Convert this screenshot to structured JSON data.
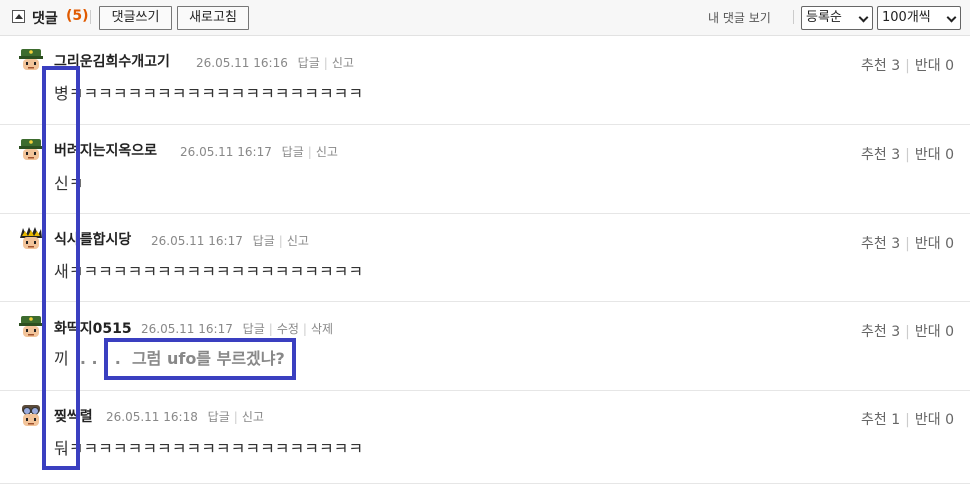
{
  "topbar": {
    "title": "댓글",
    "count": "(5)",
    "write_button": "댓글쓰기",
    "refresh_button": "새로고침",
    "my_comments": "내 댓글 보기",
    "sort_select": "등록순",
    "page_size_select": "100개씩"
  },
  "comments": [
    {
      "author": "그리운김희수개고기",
      "time": "26.05.11 16:16",
      "actions": [
        "답글",
        "신고"
      ],
      "text": "병ㅋㅋㅋㅋㅋㅋㅋㅋㅋㅋㅋㅋㅋㅋㅋㅋㅋㅋㅋㅋ",
      "up_label": "추천 3",
      "down_label": "반대 0"
    },
    {
      "author": "버려지는지옥으로",
      "time": "26.05.11 16:17",
      "actions": [
        "답글",
        "신고"
      ],
      "text": "신ㅋ",
      "up_label": "추천 3",
      "down_label": "반대 0"
    },
    {
      "author": "식사를합시당",
      "time": "26.05.11 16:17",
      "actions": [
        "답글",
        "신고"
      ],
      "text": "새ㅋㅋㅋㅋㅋㅋㅋㅋㅋㅋㅋㅋㅋㅋㅋㅋㅋㅋㅋㅋ",
      "up_label": "추천 3",
      "down_label": "반대 0"
    },
    {
      "author": "화딱지0515",
      "time": "26.05.11 16:17",
      "actions": [
        "답글",
        "수정",
        "삭제"
      ],
      "text_prefix": "끼",
      "text_dots": ". . . .",
      "text_quote": "그럼 ufo를 부르겠냐?",
      "up_label": "추천 3",
      "down_label": "반대 0"
    },
    {
      "author": "찢씩렬",
      "time": "26.05.11 16:18",
      "actions": [
        "답글",
        "신고"
      ],
      "text": "둬ㅋㅋㅋㅋㅋㅋㅋㅋㅋㅋㅋㅋㅋㅋㅋㅋㅋㅋㅋㅋ",
      "up_label": "추천 1",
      "down_label": "반대 0"
    }
  ]
}
